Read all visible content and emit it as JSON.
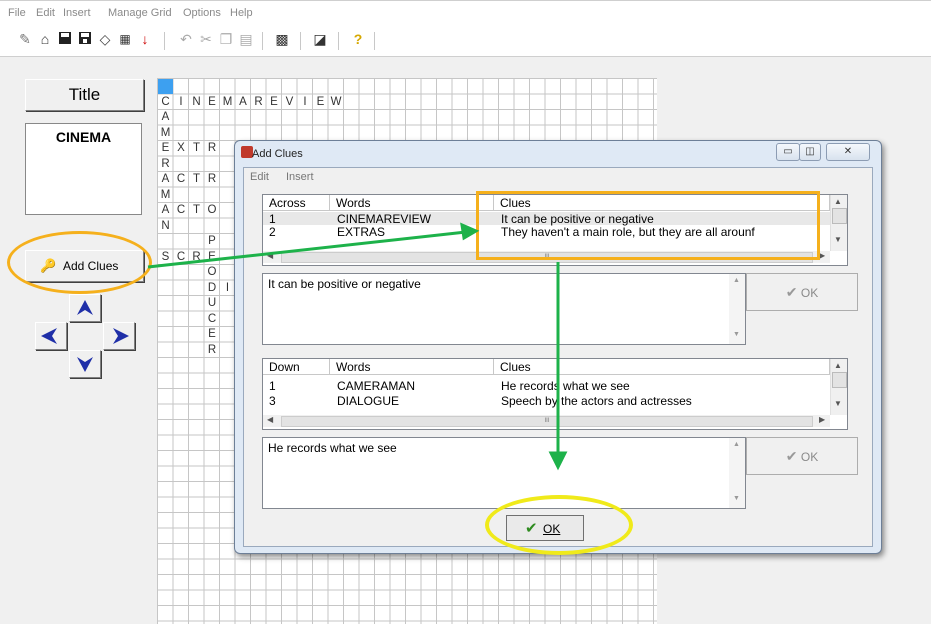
{
  "menu": [
    "File",
    "Edit",
    "Insert",
    "Manage Grid",
    "Options",
    "Help"
  ],
  "toolbar_icons": [
    "new-icon",
    "open-icon",
    "save-icon",
    "save-as-icon",
    "eraser-icon",
    "grid-icon",
    "download-icon",
    "undo-icon",
    "cut-icon",
    "copy-icon",
    "paste-icon",
    "grid-build-icon",
    "presentation-icon",
    "help-icon"
  ],
  "left": {
    "title_button": "Title",
    "title_value": "CINEMA",
    "add_clues_button": "Add Clues"
  },
  "grid": {
    "letters": [
      {
        "r": 1,
        "c": 0,
        "t": "C"
      },
      {
        "r": 1,
        "c": 1,
        "t": "I"
      },
      {
        "r": 1,
        "c": 2,
        "t": "N"
      },
      {
        "r": 1,
        "c": 3,
        "t": "E"
      },
      {
        "r": 1,
        "c": 4,
        "t": "M"
      },
      {
        "r": 1,
        "c": 5,
        "t": "A"
      },
      {
        "r": 1,
        "c": 6,
        "t": "R"
      },
      {
        "r": 1,
        "c": 7,
        "t": "E"
      },
      {
        "r": 1,
        "c": 8,
        "t": "V"
      },
      {
        "r": 1,
        "c": 9,
        "t": "I"
      },
      {
        "r": 1,
        "c": 10,
        "t": "E"
      },
      {
        "r": 1,
        "c": 11,
        "t": "W"
      },
      {
        "r": 2,
        "c": 0,
        "t": "A"
      },
      {
        "r": 3,
        "c": 0,
        "t": "M"
      },
      {
        "r": 4,
        "c": 0,
        "t": "E"
      },
      {
        "r": 4,
        "c": 1,
        "t": "X"
      },
      {
        "r": 4,
        "c": 2,
        "t": "T"
      },
      {
        "r": 4,
        "c": 3,
        "t": "R"
      },
      {
        "r": 5,
        "c": 0,
        "t": "R"
      },
      {
        "r": 6,
        "c": 0,
        "t": "A"
      },
      {
        "r": 6,
        "c": 1,
        "t": "C"
      },
      {
        "r": 6,
        "c": 2,
        "t": "T"
      },
      {
        "r": 6,
        "c": 3,
        "t": "R"
      },
      {
        "r": 7,
        "c": 0,
        "t": "M"
      },
      {
        "r": 8,
        "c": 0,
        "t": "A"
      },
      {
        "r": 8,
        "c": 1,
        "t": "C"
      },
      {
        "r": 8,
        "c": 2,
        "t": "T"
      },
      {
        "r": 8,
        "c": 3,
        "t": "O"
      },
      {
        "r": 9,
        "c": 0,
        "t": "N"
      },
      {
        "r": 10,
        "c": 3,
        "t": "P"
      },
      {
        "r": 11,
        "c": 0,
        "t": "S"
      },
      {
        "r": 11,
        "c": 1,
        "t": "C"
      },
      {
        "r": 11,
        "c": 2,
        "t": "R"
      },
      {
        "r": 11,
        "c": 3,
        "t": "E"
      },
      {
        "r": 12,
        "c": 3,
        "t": "O"
      },
      {
        "r": 13,
        "c": 3,
        "t": "D"
      },
      {
        "r": 13,
        "c": 4,
        "t": "I"
      },
      {
        "r": 14,
        "c": 3,
        "t": "U"
      },
      {
        "r": 15,
        "c": 3,
        "t": "C"
      },
      {
        "r": 16,
        "c": 3,
        "t": "E"
      },
      {
        "r": 17,
        "c": 3,
        "t": "R"
      }
    ]
  },
  "dialog": {
    "title": "Add Clues",
    "menu": [
      "Edit",
      "Insert"
    ],
    "across": {
      "headers": [
        "Across",
        "Words",
        "Clues"
      ],
      "rows": [
        {
          "num": "1",
          "word": "CINEMAREVIEW",
          "clue": "It can be positive or negative"
        },
        {
          "num": "2",
          "word": "EXTRAS",
          "clue": "They haven't a main role, but they are all arounf"
        }
      ],
      "edit_text": "It can be positive or negative",
      "ok_label": "OK"
    },
    "down": {
      "headers": [
        "Down",
        "Words",
        "Clues"
      ],
      "rows": [
        {
          "num": "1",
          "word": "CAMERAMAN",
          "clue": "He records what we see"
        },
        {
          "num": "3",
          "word": "DIALOGUE",
          "clue": "Speech by the actors and actresses"
        }
      ],
      "edit_text": "He records what we see",
      "ok_label": "OK"
    },
    "ok_button": "OK",
    "scroll_dots": "III"
  },
  "colors": {
    "orange_highlight": "#f5b01c",
    "yellow_highlight": "#f0ea1a",
    "green_arrow": "#1db24a",
    "ok_check": "#2e8b1f",
    "nav_arrow": "#1f2fa8"
  }
}
